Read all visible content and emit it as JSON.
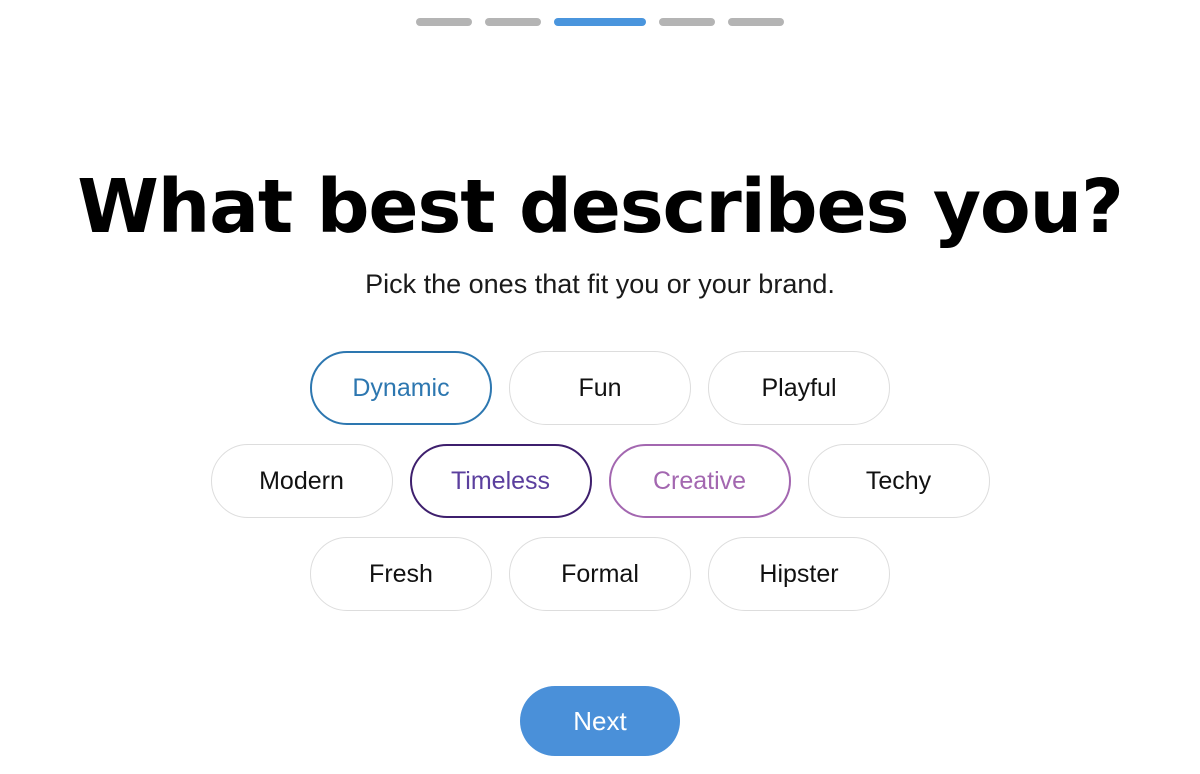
{
  "progress": {
    "total_steps": 5,
    "current_step": 3,
    "segments": [
      {
        "state": "inactive"
      },
      {
        "state": "inactive"
      },
      {
        "state": "active"
      },
      {
        "state": "inactive"
      },
      {
        "state": "inactive"
      }
    ],
    "active_color": "#4a95dd",
    "inactive_color": "#b4b4b4"
  },
  "heading": {
    "title": "What best describes you?",
    "subtitle": "Pick the ones that fit you or your brand."
  },
  "options": {
    "rows": [
      [
        {
          "label": "Dynamic",
          "selected": true,
          "style": "sel-blue"
        },
        {
          "label": "Fun",
          "selected": false,
          "style": ""
        },
        {
          "label": "Playful",
          "selected": false,
          "style": ""
        }
      ],
      [
        {
          "label": "Modern",
          "selected": false,
          "style": ""
        },
        {
          "label": "Timeless",
          "selected": true,
          "style": "sel-violet"
        },
        {
          "label": "Creative",
          "selected": true,
          "style": "sel-orchid"
        },
        {
          "label": "Techy",
          "selected": false,
          "style": ""
        }
      ],
      [
        {
          "label": "Fresh",
          "selected": false,
          "style": ""
        },
        {
          "label": "Formal",
          "selected": false,
          "style": ""
        },
        {
          "label": "Hipster",
          "selected": false,
          "style": ""
        }
      ]
    ],
    "selected_labels": [
      "Dynamic",
      "Timeless",
      "Creative"
    ],
    "colors": {
      "unselected_border": "#dddddd",
      "unselected_text": "#111111",
      "dynamic_border": "#2d77b0",
      "dynamic_text": "#2d77b0",
      "timeless_border": "#3e1f6d",
      "timeless_text": "#5b3f9e",
      "creative_border": "#a367b0",
      "creative_text": "#a367b0"
    }
  },
  "footer": {
    "next_label": "Next",
    "next_bg": "#4a90d9",
    "next_text_color": "#ffffff"
  }
}
